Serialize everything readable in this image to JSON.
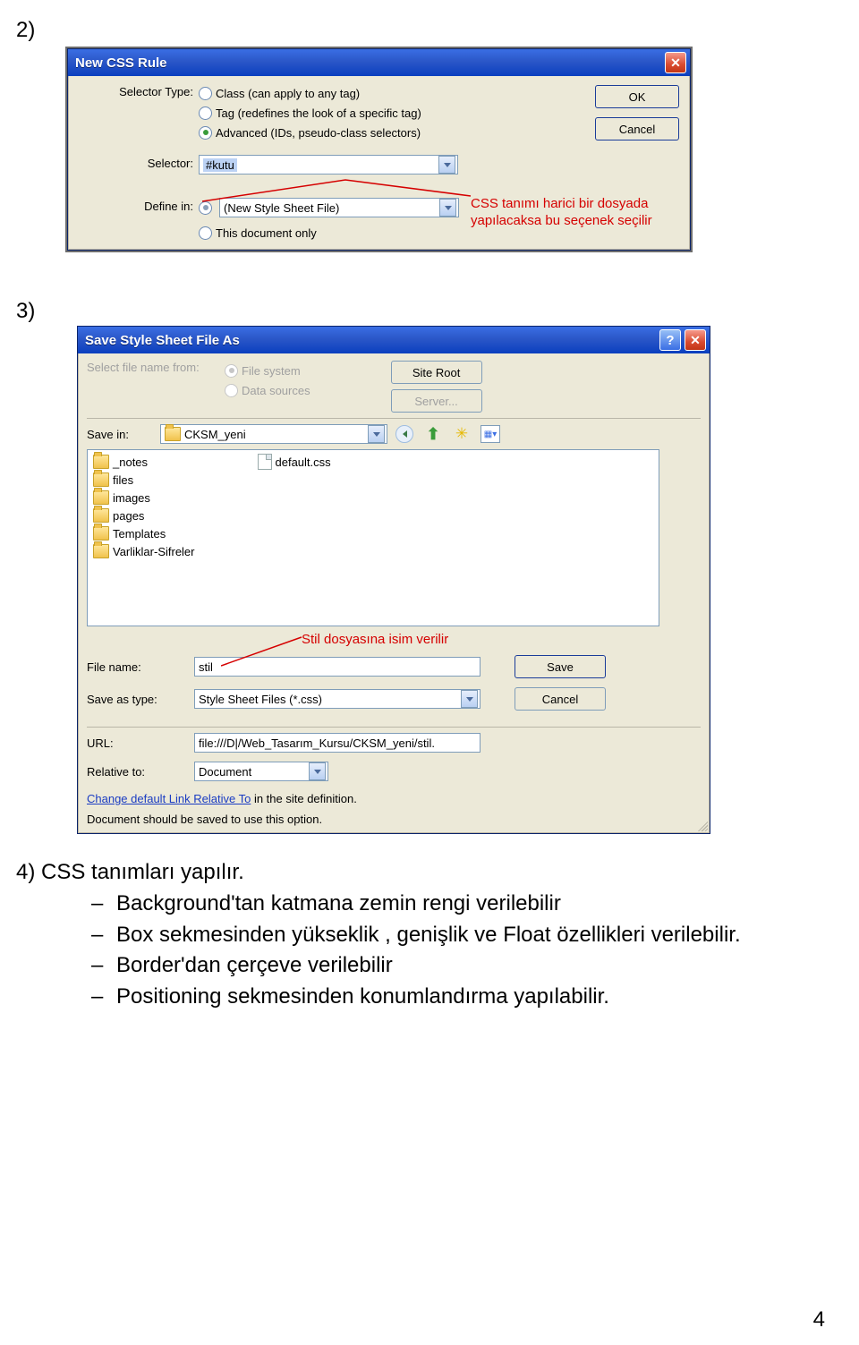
{
  "steps": {
    "s2": "2)",
    "s3": "3)",
    "s4_head": "4) CSS tanımları yapılır."
  },
  "dlg1": {
    "title": "New CSS Rule",
    "selector_type_label": "Selector Type:",
    "radios": [
      "Class (can apply to any tag)",
      "Tag (redefines the look of a specific tag)",
      "Advanced (IDs, pseudo-class selectors)"
    ],
    "selector_label": "Selector:",
    "selector_value": "#kutu",
    "definein_label": "Define in:",
    "definein_opts": [
      "(New Style Sheet File)",
      "This document only"
    ],
    "ok": "OK",
    "cancel": "Cancel",
    "annotation": "CSS tanımı harici bir dosyada yapılacaksa bu seçenek seçilir"
  },
  "dlg2": {
    "title": "Save Style Sheet File As",
    "select_from_label": "Select file name from:",
    "src_opts": [
      "File system",
      "Data sources"
    ],
    "site_root": "Site Root",
    "server": "Server...",
    "save_in_label": "Save in:",
    "save_in_value": "CKSM_yeni",
    "folders": [
      "_notes",
      "files",
      "images",
      "pages",
      "Templates",
      "Varliklar-Sifreler"
    ],
    "file_item": "default.css",
    "file_name_label": "File name:",
    "file_name_value": "stil",
    "save_as_type_label": "Save as type:",
    "save_as_type_value": "Style Sheet Files (*.css)",
    "save": "Save",
    "cancel": "Cancel",
    "url_label": "URL:",
    "url_value": "file:///D|/Web_Tasarım_Kursu/CKSM_yeni/stil.",
    "relative_to_label": "Relative to:",
    "relative_to_value": "Document",
    "link_text": "Change default Link Relative To",
    "link_tail": " in the site definition.",
    "note": "Document should be saved to use this option.",
    "annotation": "Stil dosyasına isim verilir"
  },
  "bullets": [
    "Background'tan katmana zemin rengi verilebilir",
    "Box sekmesinden yükseklik , genişlik ve Float özellikleri verilebilir.",
    "Border'dan çerçeve verilebilir",
    "Positioning sekmesinden konumlandırma yapılabilir."
  ],
  "page_number": "4"
}
